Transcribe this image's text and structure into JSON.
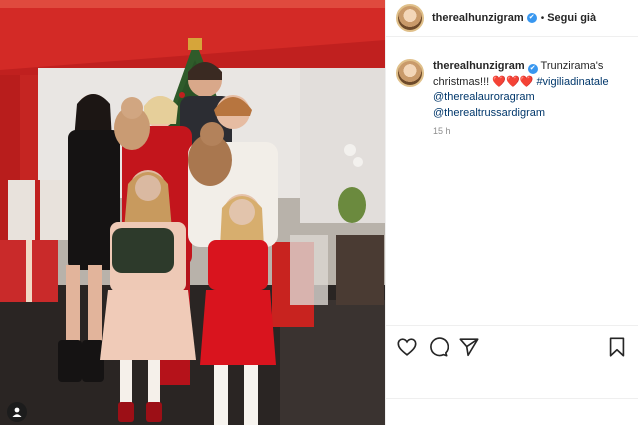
{
  "post": {
    "username": "therealhunzigram",
    "verified_mark": "✔",
    "separator": "•",
    "follow_label": "Segui già",
    "caption": {
      "text": "Trunzirama's christmas!!! ❤️❤️❤️",
      "hashtag": "#vigiliadinatale",
      "mentions": [
        "@therealauroragram",
        "@therealtrussardigram"
      ]
    },
    "time_ago": "15 h"
  },
  "icons": {
    "like": "heart-icon",
    "comment": "comment-icon",
    "share": "paper-plane-icon",
    "save": "bookmark-icon",
    "tag": "user-tag-icon"
  },
  "colors": {
    "verified": "#3897f0",
    "link": "#00376b",
    "muted": "#8e8e8e",
    "heart": "#ed4956"
  }
}
